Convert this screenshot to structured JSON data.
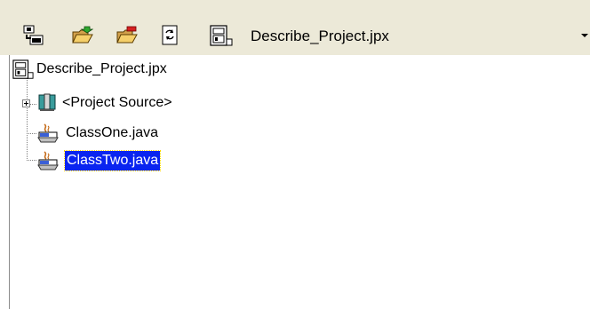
{
  "toolbar": {
    "buttons": [
      {
        "icon": "new-project-icon"
      },
      {
        "icon": "add-files-icon"
      },
      {
        "icon": "remove-files-icon"
      },
      {
        "icon": "refresh-icon"
      }
    ],
    "project_select": {
      "icon": "project-file-icon",
      "value": "Describe_Project.jpx"
    }
  },
  "tree": {
    "root": {
      "label": "Describe_Project.jpx",
      "icon": "project-file-icon"
    },
    "children": [
      {
        "label": "<Project Source>",
        "icon": "package-source-icon",
        "expandable": true
      },
      {
        "label": "ClassOne.java",
        "icon": "java-file-icon"
      },
      {
        "label": "ClassTwo.java",
        "icon": "java-file-icon",
        "selected": true
      }
    ]
  },
  "colors": {
    "toolbar_bg": "#ece9d8",
    "selection_bg": "#0a24f0",
    "selection_outline": "#ffd400"
  }
}
